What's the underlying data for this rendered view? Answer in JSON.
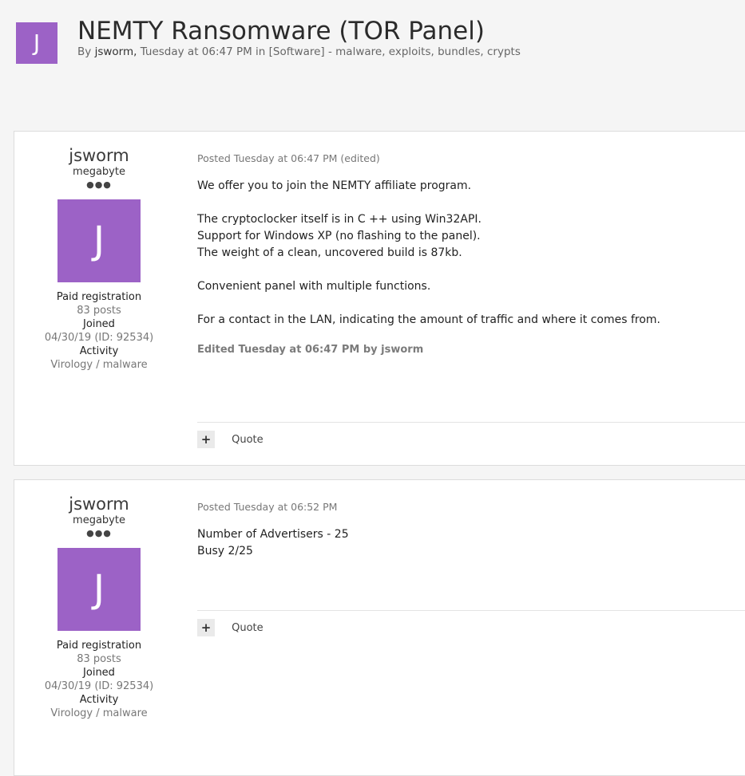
{
  "topic": {
    "avatar_letter": "J",
    "title": "NEMTY Ransomware (TOR Panel)",
    "by": "By",
    "author": "jsworm,",
    "when": "Tuesday at 06:47 PM in",
    "forum": "[Software] - malware, exploits, bundles, crypts"
  },
  "posts": [
    {
      "author": {
        "name": "jsworm",
        "rank": "megabyte",
        "pips": "●●●",
        "avatar_letter": "J",
        "group": "Paid registration",
        "posts": "83 posts",
        "joined_label": "Joined",
        "joined_value": "04/30/19 (ID: 92534)",
        "activity_label": "Activity",
        "activity_value": "Virology / malware"
      },
      "posted": "Posted Tuesday at 06:47 PM (edited)",
      "lines": [
        "We offer you to join the NEMTY affiliate program.",
        "The cryptoclocker itself is in C ++ using Win32API.",
        "Support for Windows XP (no flashing to the panel).",
        "The weight of a clean, uncovered build is 87kb.",
        "Convenient panel with multiple functions.",
        "For a contact in the LAN, indicating the amount of traffic and where it comes from."
      ],
      "edited": "Edited Tuesday at 06:47 PM by jsworm",
      "plus": "+",
      "quote": "Quote"
    },
    {
      "author": {
        "name": "jsworm",
        "rank": "megabyte",
        "pips": "●●●",
        "avatar_letter": "J",
        "group": "Paid registration",
        "posts": "83 posts",
        "joined_label": "Joined",
        "joined_value": "04/30/19 (ID: 92534)",
        "activity_label": "Activity",
        "activity_value": "Virology / malware"
      },
      "posted": "Posted Tuesday at 06:52 PM",
      "lines": [
        "Number of Advertisers - 25",
        "Busy 2/25"
      ],
      "plus": "+",
      "quote": "Quote"
    }
  ]
}
